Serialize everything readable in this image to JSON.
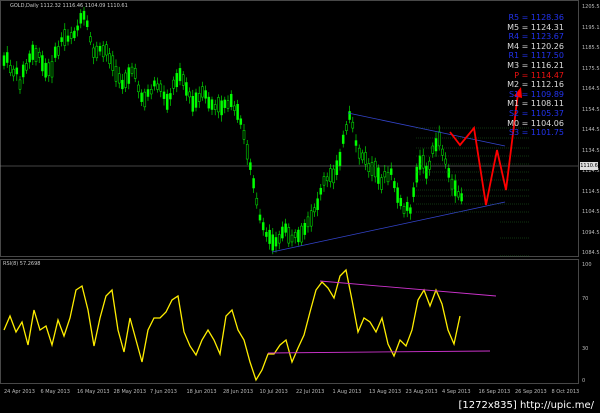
{
  "symbol_header": "GOLD,Daily  1112.32  1116.46  1104.09  1110.61",
  "rsi_header": "RSI(8) 57.2698",
  "current_price": "1110.6",
  "watermark": "[1272x835] http://upic.me/",
  "pivot_levels": [
    {
      "label": "R5 = 1128.36",
      "color": "#2233ee"
    },
    {
      "label": "M5 = 1124.31",
      "color": "#dddddd"
    },
    {
      "label": "R4 = 1123.67",
      "color": "#2233ee"
    },
    {
      "label": "M4 = 1120.26",
      "color": "#dddddd"
    },
    {
      "label": "R1 = 1117.50",
      "color": "#2233ee"
    },
    {
      "label": "M3 = 1116.21",
      "color": "#dddddd"
    },
    {
      "label": "P = 1114.47",
      "color": "#ee1111"
    },
    {
      "label": "M2 = 1112.16",
      "color": "#dddddd"
    },
    {
      "label": "S1 = 1109.89",
      "color": "#2233ee"
    },
    {
      "label": "M1 = 1108.11",
      "color": "#dddddd"
    },
    {
      "label": "S2 = 1105.37",
      "color": "#2233ee"
    },
    {
      "label": "M0 = 1104.06",
      "color": "#dddddd"
    },
    {
      "label": "S3 = 1101.75",
      "color": "#2233ee"
    }
  ],
  "price_axis": [
    "1205.55",
    "1195.15",
    "1185.55",
    "1175.55",
    "1164.55",
    "1154.55",
    "1144.55",
    "1134.55",
    "1124.55",
    "1114.55",
    "1104.55",
    "1094.55",
    "1084.55"
  ],
  "rsi_axis": [
    "100",
    "70",
    "30",
    "0"
  ],
  "date_axis": [
    "24 Apr 2013",
    "6 May 2013",
    "16 May 2013",
    "28 May 2013",
    "7 Jun 2013",
    "18 Jun 2013",
    "28 Jun 2013",
    "10 Jul 2013",
    "22 Jul 2013",
    "1 Aug 2013",
    "13 Aug 2013",
    "23 Aug 2013",
    "4 Sep 2013",
    "16 Sep 2013",
    "26 Sep 2013",
    "8 Oct 2013"
  ],
  "colors": {
    "background": "#000000",
    "bull_candle": "#00ff00",
    "bear_candle": "#00dd00",
    "rsi_line": "#ffee00",
    "trendline": "#3344cc",
    "rsi_trendline": "#cc33cc",
    "projection": "#ff0000"
  }
}
